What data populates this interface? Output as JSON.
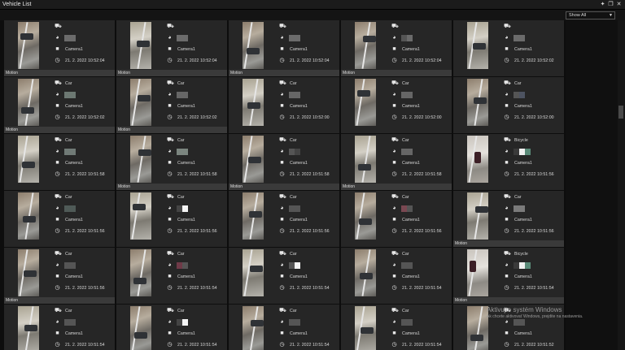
{
  "window": {
    "title": "Vehicle List"
  },
  "filter": {
    "selected": "Show All"
  },
  "labels": {
    "motion": "Motion",
    "camera": "Camera1"
  },
  "icons": {
    "vehicle": "car-icon",
    "color": "palette-icon",
    "camera": "camera-icon",
    "time": "clock-icon"
  },
  "watermark": {
    "line1": "Aktivujte systém Windows",
    "line2": "Ak chcete aktivovať Windows, prejdite na nastavenia."
  },
  "cards": [
    {
      "type": "",
      "colors": [
        "#6b6b6b",
        "#6b6b6b"
      ],
      "time": "21. 2. 2022 10:52:04",
      "motion": true
    },
    {
      "type": "",
      "colors": [
        "#6b6b6b",
        "#6b6b6b"
      ],
      "time": "21. 2. 2022 10:52:04",
      "motion": true
    },
    {
      "type": "",
      "colors": [
        "#6b6b6b",
        "#6b6b6b"
      ],
      "time": "21. 2. 2022 10:52:04",
      "motion": true
    },
    {
      "type": "",
      "colors": [
        "#555",
        "#6b6b6b"
      ],
      "time": "21. 2. 2022 10:52:04",
      "motion": true
    },
    {
      "type": "",
      "colors": [
        "#6b6b6b",
        "#6b6b6b"
      ],
      "time": "21. 2. 2022 10:52:02",
      "motion": false
    },
    {
      "type": "Car",
      "colors": [
        "#6c7872",
        "#6c7872"
      ],
      "time": "21. 2. 2022 10:52:02",
      "motion": true
    },
    {
      "type": "Car",
      "colors": [
        "#666",
        "#666"
      ],
      "time": "21. 2. 2022 10:52:02",
      "motion": true
    },
    {
      "type": "Car",
      "colors": [
        "#666",
        "#666"
      ],
      "time": "21. 2. 2022 10:52:00",
      "motion": false
    },
    {
      "type": "Car",
      "colors": [
        "#666",
        "#666"
      ],
      "time": "21. 2. 2022 10:52:00",
      "motion": false
    },
    {
      "type": "Car",
      "colors": [
        "#555",
        "#4d5361"
      ],
      "time": "21. 2. 2022 10:52:00",
      "motion": false
    },
    {
      "type": "Car",
      "colors": [
        "#707a76",
        "#707a76"
      ],
      "time": "21. 2. 2022 10:51:58",
      "motion": false
    },
    {
      "type": "Car",
      "colors": [
        "#7b857f",
        "#7b857f"
      ],
      "time": "21. 2. 2022 10:51:58",
      "motion": true
    },
    {
      "type": "Car",
      "colors": [
        "#555",
        "#444"
      ],
      "time": "21. 2. 2022 10:51:58",
      "motion": true
    },
    {
      "type": "Car",
      "colors": [
        "#666",
        "#666"
      ],
      "time": "21. 2. 2022 10:51:58",
      "motion": true
    },
    {
      "type": "Bicycle",
      "colors": [
        "#3a3a3a",
        "#f0f0f0",
        "#5a8a78"
      ],
      "time": "21. 2. 2022 10:51:56",
      "motion": false
    },
    {
      "type": "Car",
      "colors": [
        "#4f5a57",
        "#4f5a57"
      ],
      "time": "21. 2. 2022 10:51:56",
      "motion": false
    },
    {
      "type": "Car",
      "colors": [
        "#444",
        "#f4f4f4"
      ],
      "time": "21. 2. 2022 10:51:56",
      "motion": false
    },
    {
      "type": "Car",
      "colors": [
        "#555",
        "#555"
      ],
      "time": "21. 2. 2022 10:51:56",
      "motion": false
    },
    {
      "type": "Car",
      "colors": [
        "#7a4852",
        "#555"
      ],
      "time": "21. 2. 2022 10:51:56",
      "motion": false
    },
    {
      "type": "Car",
      "colors": [
        "#7a7a7a",
        "#7a7a7a"
      ],
      "time": "21. 2. 2022 10:51:56",
      "motion": true
    },
    {
      "type": "Car",
      "colors": [
        "#555",
        "#555"
      ],
      "time": "21. 2. 2022 10:51:56",
      "motion": true
    },
    {
      "type": "Car",
      "colors": [
        "#6f3a48",
        "#555"
      ],
      "time": "21. 2. 2022 10:51:54",
      "motion": false
    },
    {
      "type": "Car",
      "colors": [
        "#555",
        "#f4f4f4"
      ],
      "time": "21. 2. 2022 10:51:54",
      "motion": false
    },
    {
      "type": "Car",
      "colors": [
        "#555",
        "#555"
      ],
      "time": "21. 2. 2022 10:51:54",
      "motion": false
    },
    {
      "type": "Bicycle",
      "colors": [
        "#3a3a3a",
        "#f0f0f0",
        "#5a8a78"
      ],
      "time": "21. 2. 2022 10:51:54",
      "motion": true
    },
    {
      "type": "Car",
      "colors": [
        "#555",
        "#555"
      ],
      "time": "21. 2. 2022 10:51:54",
      "motion": false
    },
    {
      "type": "Car",
      "colors": [
        "#444",
        "#f4f4f4"
      ],
      "time": "21. 2. 2022 10:51:54",
      "motion": false
    },
    {
      "type": "Car",
      "colors": [
        "#555",
        "#555"
      ],
      "time": "21. 2. 2022 10:51:54",
      "motion": false
    },
    {
      "type": "Car",
      "colors": [
        "#555",
        "#555"
      ],
      "time": "21. 2. 2022 10:51:54",
      "motion": false
    },
    {
      "type": "",
      "colors": [
        "#555",
        "#555"
      ],
      "time": "21. 2. 2022 10:51:52",
      "motion": false
    }
  ]
}
